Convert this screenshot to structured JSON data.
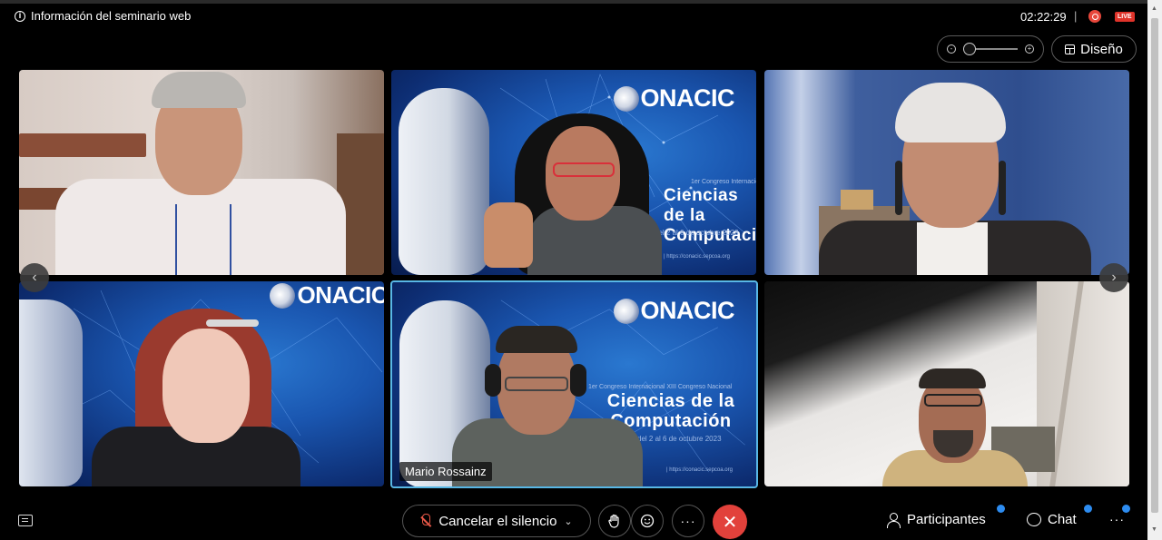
{
  "header": {
    "title": "Información del seminario web",
    "timer": "02:22:29",
    "separator": "|",
    "live_badge": "LIVE"
  },
  "view": {
    "zoom_level": 0,
    "layout_button": "Diseño"
  },
  "conference_slide": {
    "logo_text": "ONACIC",
    "subtitle": "1er Congreso Internacional XIII Congreso Nacional",
    "title_line1": "Ciencias de la",
    "title_line2": "Computación",
    "dates": "del 2 al 6 de octubre 2023",
    "url": "| https://conacic.sepcoa.org"
  },
  "participants_grid": {
    "active_speaker": "Mario Rossainz"
  },
  "controls": {
    "mute_label": "Cancelar el silencio",
    "more_label": "···",
    "end_label": "✕",
    "participants_label": "Participantes",
    "chat_label": "Chat",
    "overflow_label": "···"
  },
  "colors": {
    "accent": "#58b7e5",
    "end_call": "#e2413b",
    "live": "#e0332a",
    "notification": "#2d8cf0"
  }
}
